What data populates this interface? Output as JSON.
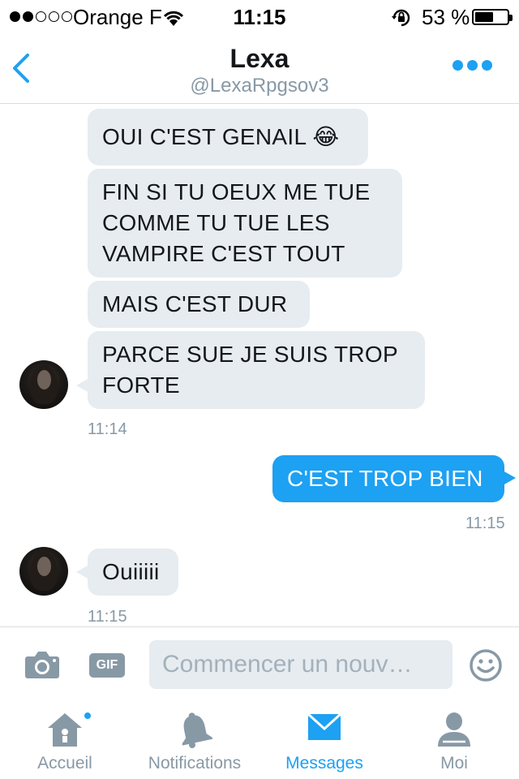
{
  "status_bar": {
    "carrier": "Orange F",
    "time": "11:15",
    "battery": "53 %",
    "signal_bars_filled": 2,
    "signal_bars_total": 5
  },
  "header": {
    "name": "Lexa",
    "handle": "@LexaRpgsov3",
    "back_icon": "chevron-left-icon",
    "more_icon": "more-dots-icon"
  },
  "messages": [
    {
      "direction": "in",
      "text": "OUI C'EST GENAIL 😂"
    },
    {
      "direction": "in",
      "lines": [
        "FIN SI TU OEUX ME TUE",
        "COMME TU TUE LES",
        "VAMPIRE C'EST TOUT"
      ]
    },
    {
      "direction": "in",
      "text": "MAIS C'EST DUR"
    },
    {
      "direction": "in",
      "lines": [
        "PARCE SUE JE SUIS TROP",
        "FORTE"
      ]
    },
    {
      "direction": "in",
      "time": "11:14"
    },
    {
      "direction": "out",
      "text": "C'EST TROP BIEN",
      "time": "11:15"
    },
    {
      "direction": "in",
      "text": "Ouiiiii",
      "time": "11:15"
    }
  ],
  "composer": {
    "placeholder": "Commencer un nouv…",
    "gif_label": "GIF"
  },
  "tabs": [
    {
      "label": "Accueil",
      "icon": "home-icon",
      "active": false,
      "has_badge": true
    },
    {
      "label": "Notifications",
      "icon": "bell-icon",
      "active": false
    },
    {
      "label": "Messages",
      "icon": "envelope-icon",
      "active": true
    },
    {
      "label": "Moi",
      "icon": "person-icon",
      "active": false
    }
  ],
  "colors": {
    "accent": "#1da1f2",
    "incoming_bubble": "#e6ecf0",
    "muted": "#8899a6"
  }
}
